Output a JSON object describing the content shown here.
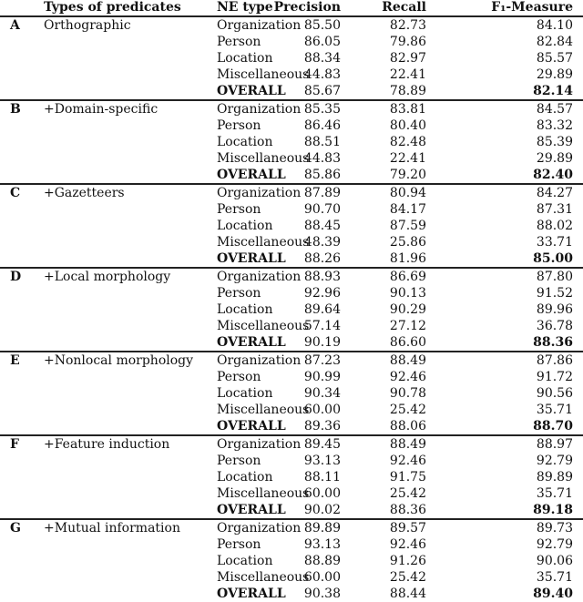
{
  "table": {
    "headers": {
      "id": "",
      "predicates": "Types of predicates",
      "ne_type": "NE type",
      "precision": "Precision",
      "recall": "Recall",
      "f1": "F₁-Measure"
    },
    "groups": [
      {
        "id": "A",
        "predicates": "Orthographic",
        "rows": [
          {
            "ne": "Organization",
            "p": "85.50",
            "r": "82.73",
            "f": "84.10"
          },
          {
            "ne": "Person",
            "p": "86.05",
            "r": "79.86",
            "f": "82.84"
          },
          {
            "ne": "Location",
            "p": "88.34",
            "r": "82.97",
            "f": "85.57"
          },
          {
            "ne": "Miscellaneous",
            "p": "44.83",
            "r": "22.41",
            "f": "29.89"
          },
          {
            "ne": "OVERALL",
            "p": "85.67",
            "r": "78.89",
            "f": "82.14"
          }
        ]
      },
      {
        "id": "B",
        "predicates": "+Domain-specific",
        "rows": [
          {
            "ne": "Organization",
            "p": "85.35",
            "r": "83.81",
            "f": "84.57"
          },
          {
            "ne": "Person",
            "p": "86.46",
            "r": "80.40",
            "f": "83.32"
          },
          {
            "ne": "Location",
            "p": "88.51",
            "r": "82.48",
            "f": "85.39"
          },
          {
            "ne": "Miscellaneous",
            "p": "44.83",
            "r": "22.41",
            "f": "29.89"
          },
          {
            "ne": "OVERALL",
            "p": "85.86",
            "r": "79.20",
            "f": "82.40"
          }
        ]
      },
      {
        "id": "C",
        "predicates": "+Gazetteers",
        "rows": [
          {
            "ne": "Organization",
            "p": "87.89",
            "r": "80.94",
            "f": "84.27"
          },
          {
            "ne": "Person",
            "p": "90.70",
            "r": "84.17",
            "f": "87.31"
          },
          {
            "ne": "Location",
            "p": "88.45",
            "r": "87.59",
            "f": "88.02"
          },
          {
            "ne": "Miscellaneous",
            "p": "48.39",
            "r": "25.86",
            "f": "33.71"
          },
          {
            "ne": "OVERALL",
            "p": "88.26",
            "r": "81.96",
            "f": "85.00"
          }
        ]
      },
      {
        "id": "D",
        "predicates": "+Local morphology",
        "rows": [
          {
            "ne": "Organization",
            "p": "88.93",
            "r": "86.69",
            "f": "87.80"
          },
          {
            "ne": "Person",
            "p": "92.96",
            "r": "90.13",
            "f": "91.52"
          },
          {
            "ne": "Location",
            "p": "89.64",
            "r": "90.29",
            "f": "89.96"
          },
          {
            "ne": "Miscellaneous",
            "p": "57.14",
            "r": "27.12",
            "f": "36.78"
          },
          {
            "ne": "OVERALL",
            "p": "90.19",
            "r": "86.60",
            "f": "88.36"
          }
        ]
      },
      {
        "id": "E",
        "predicates": "+Nonlocal morphology",
        "rows": [
          {
            "ne": "Organization",
            "p": "87.23",
            "r": "88.49",
            "f": "87.86"
          },
          {
            "ne": "Person",
            "p": "90.99",
            "r": "92.46",
            "f": "91.72"
          },
          {
            "ne": "Location",
            "p": "90.34",
            "r": "90.78",
            "f": "90.56"
          },
          {
            "ne": "Miscellaneous",
            "p": "60.00",
            "r": "25.42",
            "f": "35.71"
          },
          {
            "ne": "OVERALL",
            "p": "89.36",
            "r": "88.06",
            "f": "88.70"
          }
        ]
      },
      {
        "id": "F",
        "predicates": "+Feature induction",
        "rows": [
          {
            "ne": "Organization",
            "p": "89.45",
            "r": "88.49",
            "f": "88.97"
          },
          {
            "ne": "Person",
            "p": "93.13",
            "r": "92.46",
            "f": "92.79"
          },
          {
            "ne": "Location",
            "p": "88.11",
            "r": "91.75",
            "f": "89.89"
          },
          {
            "ne": "Miscellaneous",
            "p": "60.00",
            "r": "25.42",
            "f": "35.71"
          },
          {
            "ne": "OVERALL",
            "p": "90.02",
            "r": "88.36",
            "f": "89.18"
          }
        ]
      },
      {
        "id": "G",
        "predicates": "+Mutual information",
        "rows": [
          {
            "ne": "Organization",
            "p": "89.89",
            "r": "89.57",
            "f": "89.73"
          },
          {
            "ne": "Person",
            "p": "93.13",
            "r": "92.46",
            "f": "92.79"
          },
          {
            "ne": "Location",
            "p": "88.89",
            "r": "91.26",
            "f": "90.06"
          },
          {
            "ne": "Miscellaneous",
            "p": "60.00",
            "r": "25.42",
            "f": "35.71"
          },
          {
            "ne": "OVERALL",
            "p": "90.38",
            "r": "88.44",
            "f": "89.40"
          }
        ]
      }
    ]
  }
}
